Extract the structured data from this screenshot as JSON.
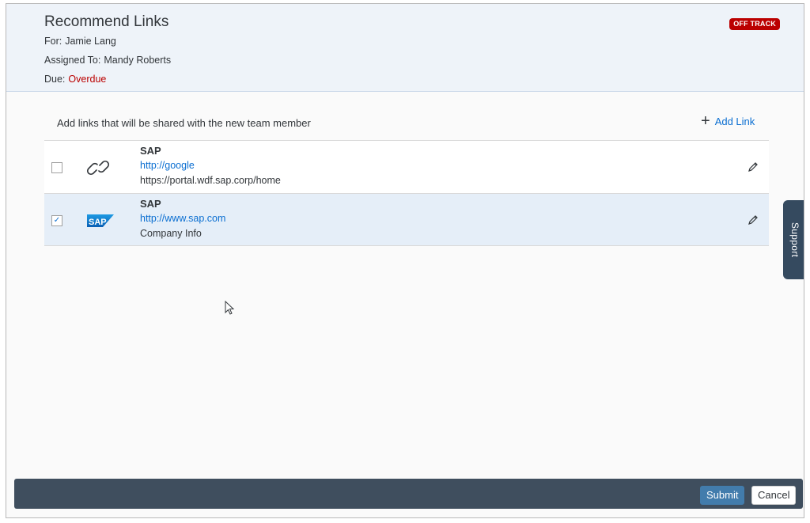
{
  "header": {
    "title": "Recommend Links",
    "for_label": "For:",
    "for_value": "Jamie Lang",
    "assigned_label": "Assigned To:",
    "assigned_value": "Mandy Roberts",
    "due_label": "Due:",
    "due_value": "Overdue",
    "status_badge": "OFF TRACK"
  },
  "content": {
    "instruction": "Add links that will be shared with the new team member",
    "add_link_icon": "+",
    "add_link_label": "Add Link",
    "links": [
      {
        "icon": "chain-link-icon",
        "name": "SAP",
        "url": "http://google",
        "description": "https://portal.wdf.sap.corp/home",
        "checked": false
      },
      {
        "icon": "sap-logo-icon",
        "name": "SAP",
        "url": "http://www.sap.com",
        "description": "Company Info",
        "checked": true
      }
    ],
    "checkmark": "✓"
  },
  "support_tab": {
    "label": "Support"
  },
  "footer": {
    "submit_label": "Submit",
    "cancel_label": "Cancel"
  },
  "colors": {
    "accent": "#0a6ed1",
    "status_red": "#bb0000",
    "footer_bg": "#3f4e5e",
    "header_bg": "#eef3f9",
    "selected_row_bg": "#e5eef8",
    "submit_bg": "#427cac"
  }
}
